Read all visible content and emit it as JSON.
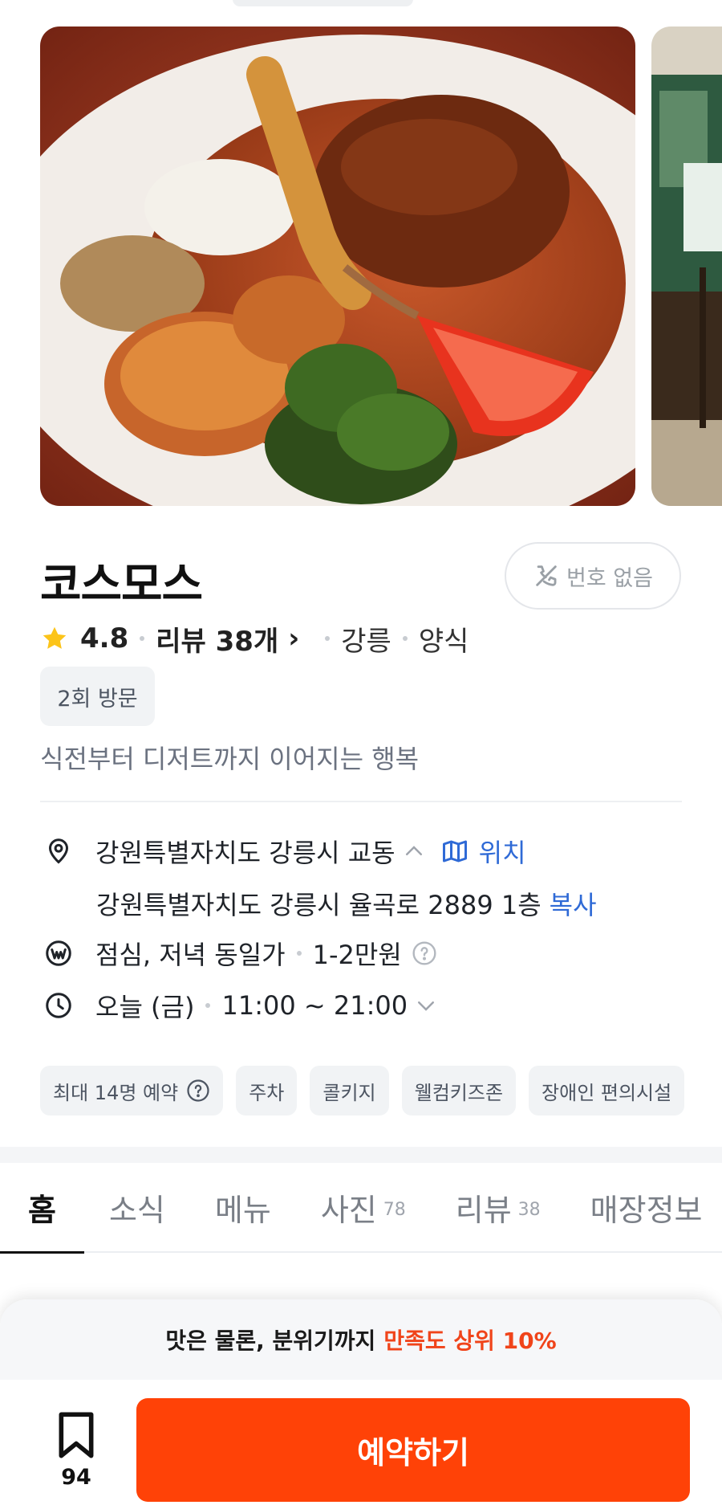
{
  "restaurant": {
    "name": "코스모스",
    "phone_status": "번호 없음",
    "rating": "4.8",
    "review_label": "리뷰 38개",
    "review_chevron": "›",
    "region": "강릉",
    "category": "양식",
    "visit_badge": "2회 방문",
    "tagline": "식전부터 디저트까지 이어지는 행복"
  },
  "info": {
    "area": "강원특별자치도 강릉시 교동",
    "map_label": "위치",
    "full_address": "강원특별자치도 강릉시 율곡로 2889 1층",
    "copy_label": "복사",
    "price_meal": "점심, 저녁 동일가",
    "price_range": "1-2만원",
    "hours_day": "오늘 (금)",
    "hours_time": "11:00 ~ 21:00"
  },
  "tags": [
    "최대 14명 예약",
    "주차",
    "콜키지",
    "웰컴키즈존",
    "장애인 편의시설"
  ],
  "tabs": [
    {
      "label": "홈",
      "count": ""
    },
    {
      "label": "소식",
      "count": ""
    },
    {
      "label": "메뉴",
      "count": ""
    },
    {
      "label": "사진",
      "count": "78"
    },
    {
      "label": "리뷰",
      "count": "38"
    },
    {
      "label": "매장정보",
      "count": ""
    }
  ],
  "bottom": {
    "promo_text": "맛은 물론, 분위기까지",
    "promo_highlight": "만족도 상위 10%",
    "bookmark_count": "94",
    "reserve_label": "예약하기"
  },
  "colors": {
    "accent": "#ff4207",
    "link": "#2f6ad6",
    "star": "#fcc419"
  },
  "icons": {
    "star": "star-icon",
    "phone_off": "phone-off-icon",
    "location": "location-pin-icon",
    "map": "map-icon",
    "price": "won-icon",
    "clock": "clock-icon",
    "help": "help-circle-icon",
    "bookmark": "bookmark-icon"
  }
}
